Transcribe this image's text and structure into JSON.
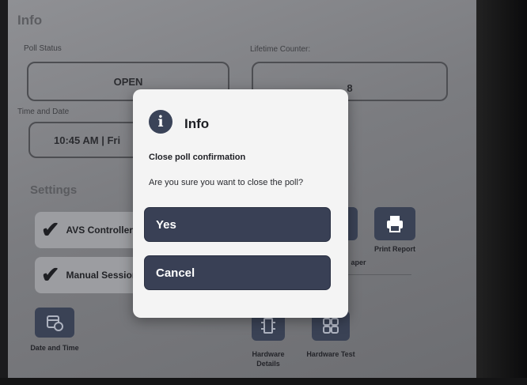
{
  "info_title": "Info",
  "poll_status": {
    "label": "Poll Status",
    "value": "OPEN"
  },
  "lifetime_counter": {
    "label": "Lifetime Counter:",
    "value": "8"
  },
  "time_and_date": {
    "label": "Time and Date",
    "value": "10:45 AM | Fri"
  },
  "settings": {
    "title": "Settings",
    "toggles": [
      {
        "label": "AVS Controller",
        "checked": true
      },
      {
        "label": "Manual Session",
        "checked": true
      }
    ]
  },
  "tiles": {
    "print_report": "Print Report",
    "paper_fragment": "aper",
    "date_time": "Date and Time",
    "hardware_details": "Hardware Details",
    "hardware_test": "Hardware Test"
  },
  "dialog": {
    "title": "Info",
    "subtitle": "Close poll confirmation",
    "message": "Are you sure you want to close the poll?",
    "yes_label": "Yes",
    "cancel_label": "Cancel"
  },
  "colors": {
    "button": "#394055",
    "dialog_bg": "#f4f4f4"
  }
}
